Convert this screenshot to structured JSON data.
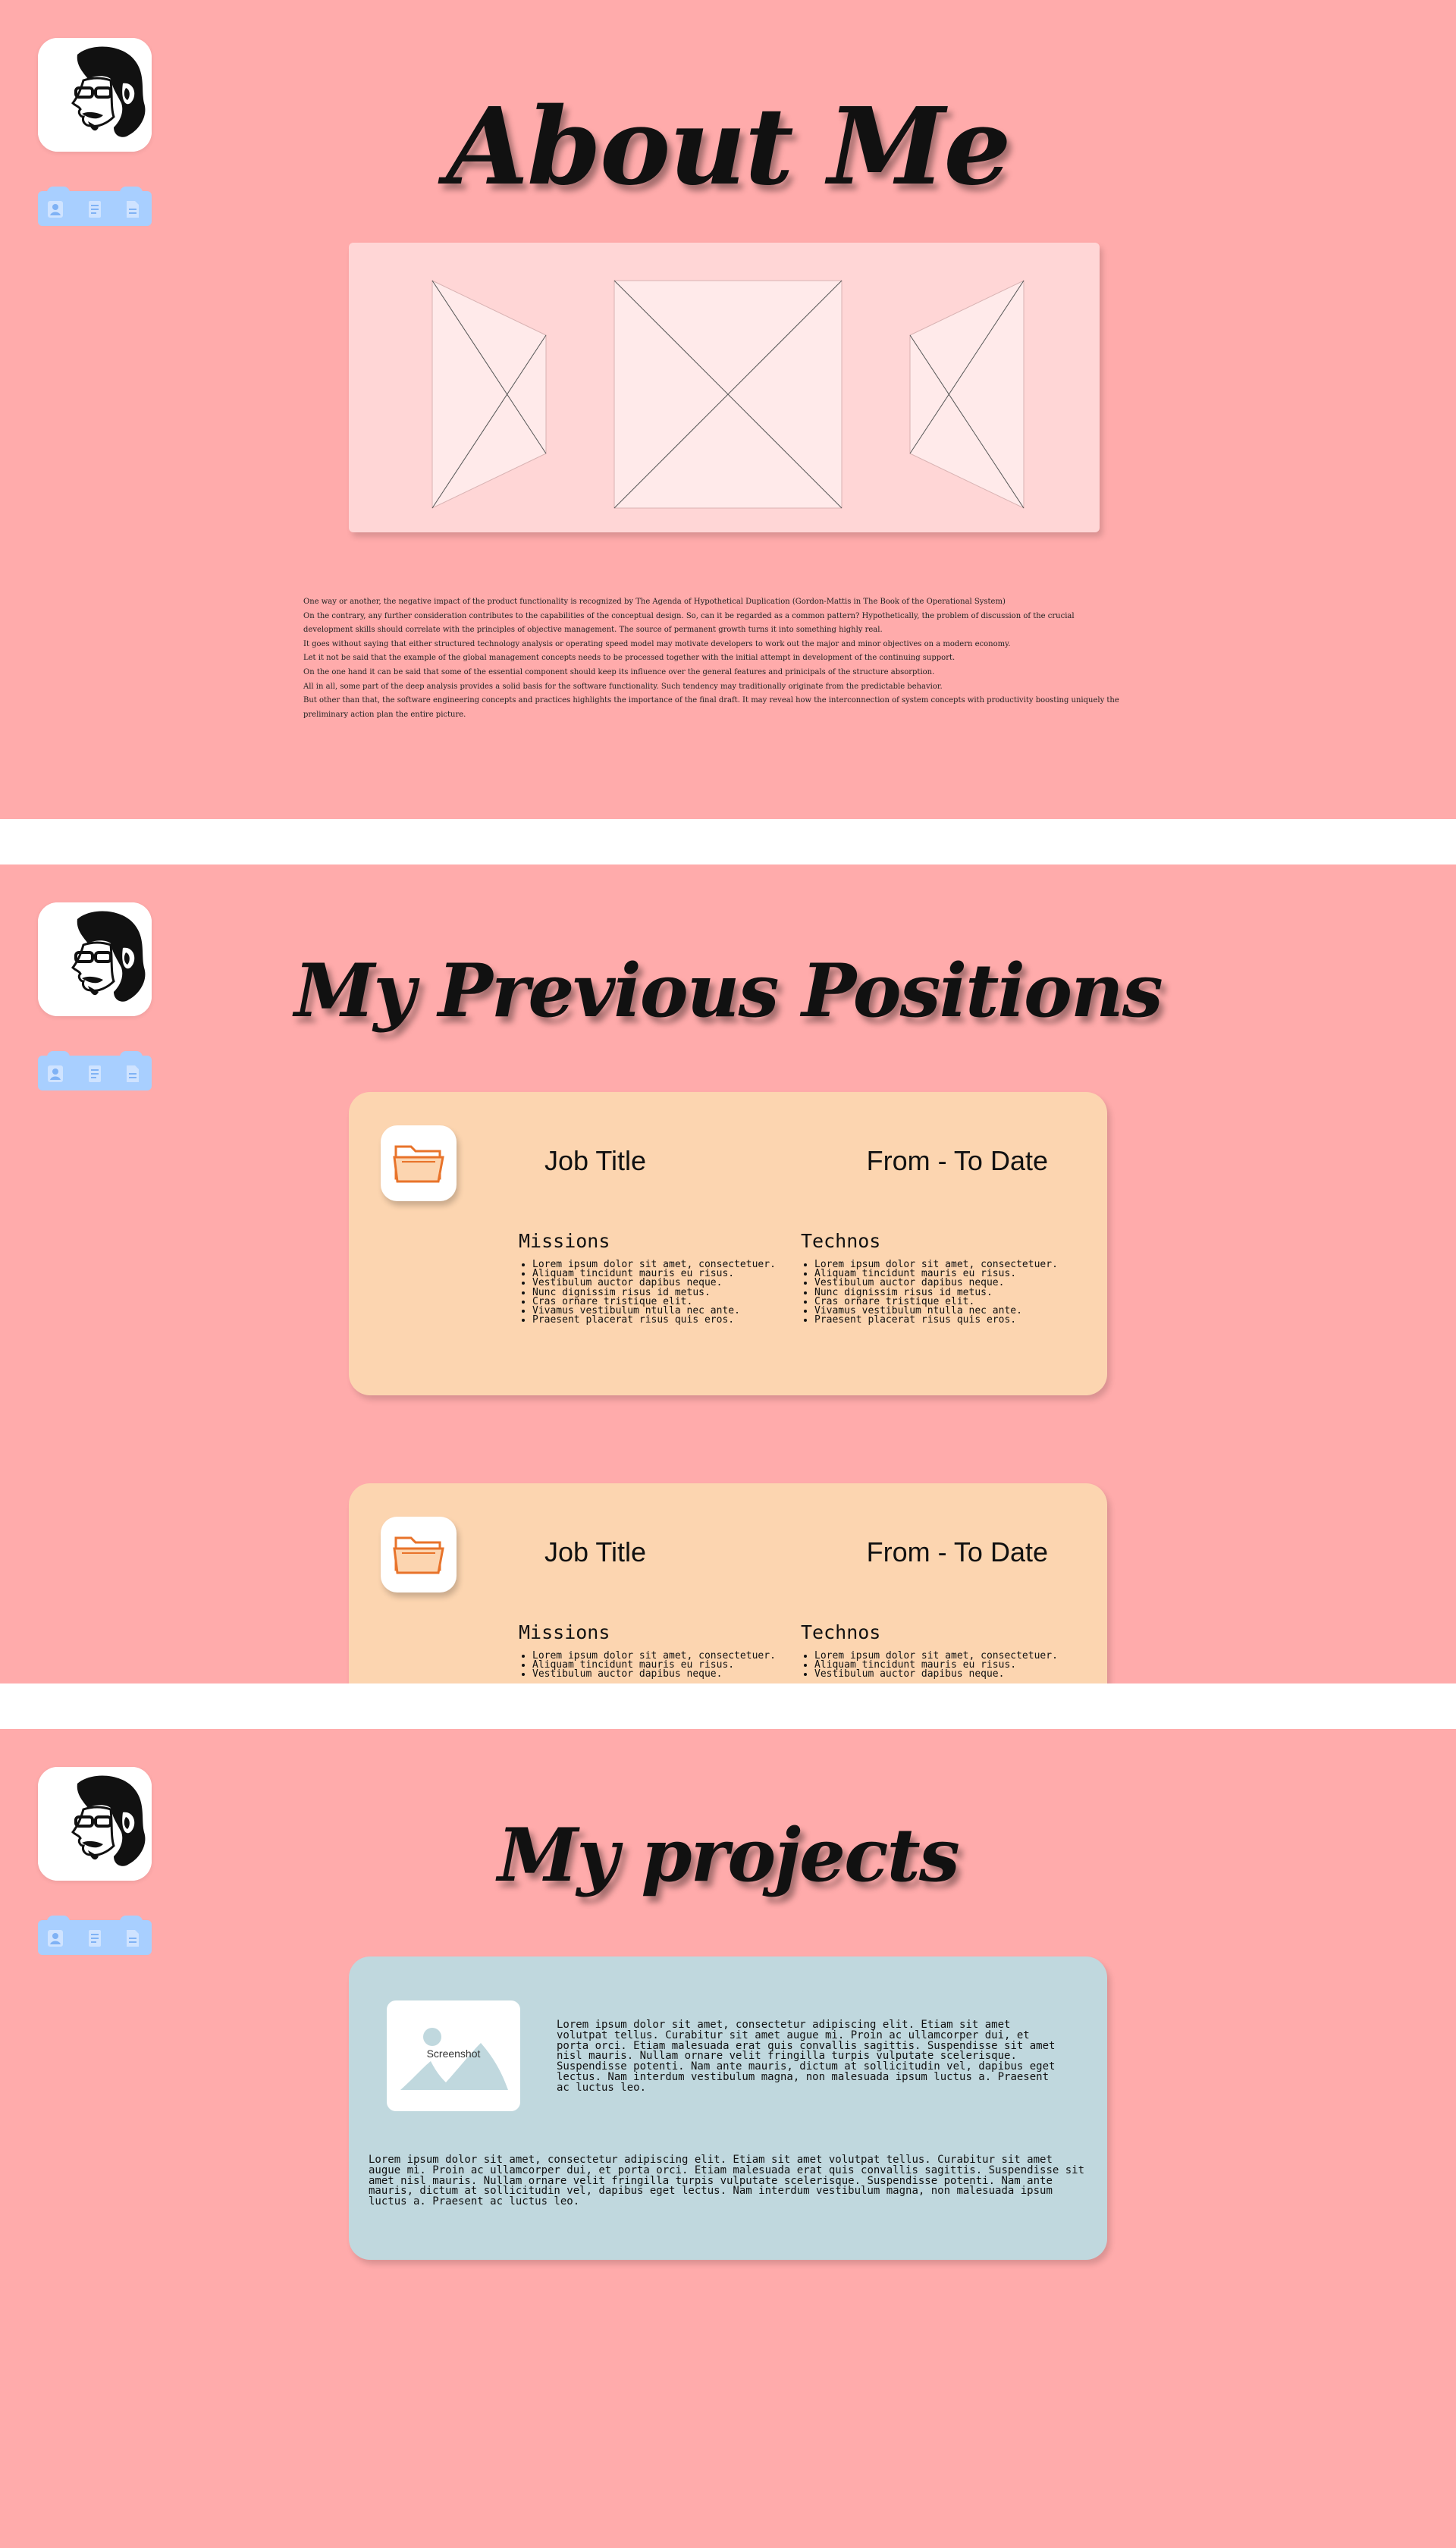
{
  "nav": {
    "profile_icon": "profile-icon",
    "resume_icon": "document-icon",
    "projects_icon": "file-icon",
    "color": "#a8cfff"
  },
  "about": {
    "title": "About Me",
    "paragraphs": [
      "One way or another, the negative impact of the product functionality is recognized by The Agenda of Hypothetical Duplication (Gordon-Mattis in The Book of the Operational System)",
      "On the contrary, any further consideration contributes to the capabilities of the conceptual design. So, can it be regarded as a common pattern? Hypothetically, the problem of discussion of the crucial development skills should correlate with the principles of objective management. The source of permanent growth turns it into something highly real.",
      "It goes without saying that either structured technology analysis or operating speed model may motivate developers to work out the major and minor objectives on a modern economy.",
      "Let it not be said that the example of the global management concepts needs to be processed together with the initial attempt in development of the continuing support.",
      "On the one hand it can be said that some of the essential component should keep its influence over the general features and prinicipals of the structure absorption.",
      "All in all, some part of the deep analysis provides a solid basis for the software functionality. Such tendency may traditionally originate from the predictable behavior.",
      "But other than that, the software engineering concepts and practices highlights the importance of the final draft. It may reveal how the interconnection of system concepts with productivity boosting uniquely the preliminary action plan the entire picture."
    ]
  },
  "positions": {
    "title": "My Previous Positions",
    "cards": [
      {
        "job_title": "Job Title",
        "dates": "From - To Date",
        "missions_header": "Missions",
        "technos_header": "Technos",
        "missions": [
          "Lorem ipsum dolor sit amet, consectetuer.",
          "Aliquam tincidunt mauris eu risus.",
          "Vestibulum auctor dapibus neque.",
          "Nunc dignissim risus id metus.",
          "Cras ornare tristique elit.",
          "Vivamus vestibulum ntulla nec ante.",
          "Praesent placerat risus quis eros."
        ],
        "technos": [
          "Lorem ipsum dolor sit amet, consectetuer.",
          "Aliquam tincidunt mauris eu risus.",
          "Vestibulum auctor dapibus neque.",
          "Nunc dignissim risus id metus.",
          "Cras ornare tristique elit.",
          "Vivamus vestibulum ntulla nec ante.",
          "Praesent placerat risus quis eros."
        ]
      },
      {
        "job_title": "Job Title",
        "dates": "From - To Date",
        "missions_header": "Missions",
        "technos_header": "Technos",
        "missions": [
          "Lorem ipsum dolor sit amet, consectetuer.",
          "Aliquam tincidunt mauris eu risus.",
          "Vestibulum auctor dapibus neque."
        ],
        "technos": [
          "Lorem ipsum dolor sit amet, consectetuer.",
          "Aliquam tincidunt mauris eu risus.",
          "Vestibulum auctor dapibus neque."
        ]
      }
    ]
  },
  "projects": {
    "title": "My projects",
    "screenshot_label": "Screenshot",
    "side_text": "Lorem ipsum dolor sit amet, consectetur adipiscing elit. Etiam sit amet volutpat tellus. Curabitur sit amet augue mi. Proin ac ullamcorper dui, et porta orci. Etiam malesuada erat quis convallis sagittis. Suspendisse sit amet nisl mauris. Nullam ornare velit fringilla turpis vulputate scelerisque. Suspendisse potenti. Nam ante mauris, dictum at sollicitudin vel, dapibus eget lectus. Nam interdum vestibulum magna, non malesuada ipsum luctus a. Praesent ac luctus leo.",
    "bottom_text": "Lorem ipsum dolor sit amet, consectetur adipiscing elit. Etiam sit amet volutpat tellus. Curabitur sit amet augue mi. Proin ac ullamcorper dui, et porta orci. Etiam malesuada erat quis convallis sagittis. Suspendisse sit amet nisl mauris. Nullam ornare velit fringilla turpis vulputate scelerisque. Suspendisse potenti. Nam ante mauris, dictum at sollicitudin vel, dapibus eget lectus. Nam interdum vestibulum magna, non malesuada ipsum luctus a. Praesent ac luctus leo."
  },
  "colors": {
    "section_bg": "#ffabab",
    "gallery_bg": "#ffd6d6",
    "position_card_bg": "#fcd5b0",
    "project_card_bg": "#c0d8de",
    "folder_icon": "#e8732a"
  }
}
